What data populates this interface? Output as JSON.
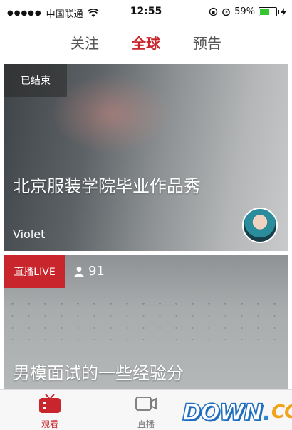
{
  "status_bar": {
    "carrier": "中国联通",
    "time": "12:55",
    "battery_pct": "59%",
    "battery_fraction": 0.59,
    "battery_color": "#35c52f"
  },
  "top_tabs": [
    {
      "label": "关注",
      "active": false
    },
    {
      "label": "全球",
      "active": true
    },
    {
      "label": "预告",
      "active": false
    }
  ],
  "accent_color": "#c8262c",
  "feed": [
    {
      "status": "已结束",
      "title": "北京服装学院毕业作品秀",
      "author": "Violet"
    },
    {
      "status": "直播LIVE",
      "viewers": "91",
      "title": "男模面试的一些经验分"
    }
  ],
  "bottom_tabs": [
    {
      "label": "观看",
      "icon": "tv-icon",
      "active": true
    },
    {
      "label": "直播",
      "icon": "video-camera-icon",
      "active": false
    }
  ],
  "watermark": {
    "text_a": "DOWN",
    "dot": ".",
    "text_b": "CC"
  }
}
